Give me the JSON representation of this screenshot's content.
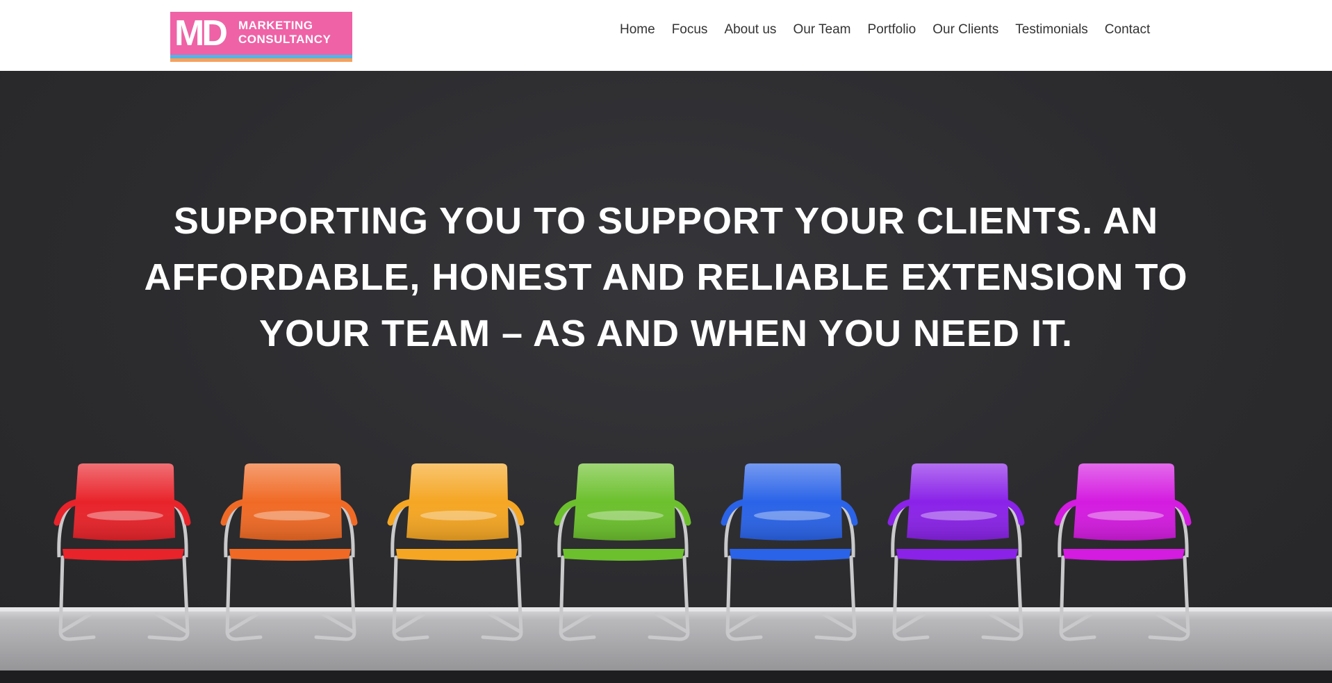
{
  "logo": {
    "line1": "MD",
    "line2": "MARKETING",
    "line3": "CONSULTANCY"
  },
  "nav": {
    "items": [
      "Home",
      "Focus",
      "About us",
      "Our Team",
      "Portfolio",
      "Our Clients",
      "Testimonials",
      "Contact"
    ]
  },
  "hero": {
    "headline": "SUPPORTING YOU TO SUPPORT YOUR CLIENTS. AN AFFORDABLE, HONEST AND RELIABLE EXTENSION TO YOUR TEAM – AS AND WHEN YOU NEED IT.",
    "chair_colors": [
      "#e8232a",
      "#f06a25",
      "#f5a623",
      "#6cc02d",
      "#2a63e8",
      "#8a22e8",
      "#d41be0"
    ]
  },
  "colors": {
    "logo_pink": "#ef62a6",
    "logo_blue": "#4eb7e9",
    "logo_orange": "#f7a05b",
    "hero_bg": "#2b2b2d"
  }
}
